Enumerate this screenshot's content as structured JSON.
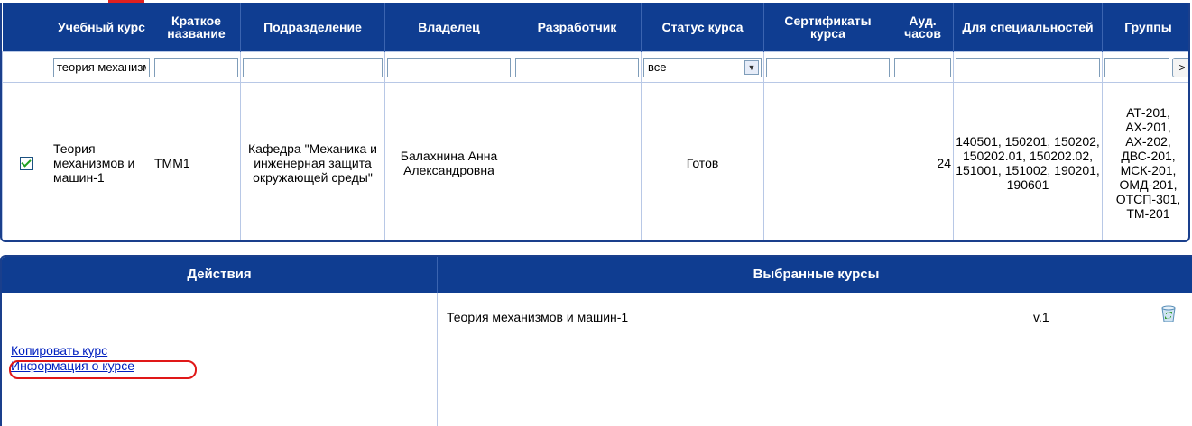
{
  "headers": {
    "course": "Учебный курс",
    "short_name": "Краткое название",
    "department": "Подразделение",
    "owner": "Владелец",
    "developer": "Разработчик",
    "status": "Статус курса",
    "certificates": "Сертификаты курса",
    "hours": "Ауд. часов",
    "specialties": "Для специальностей",
    "groups": "Группы"
  },
  "filters": {
    "course_value": "теория механизмов",
    "status_value": "все",
    "go_label": ">"
  },
  "row": {
    "course": "Теория механизмов и машин-1",
    "short_name": "ТММ1",
    "department": "Кафедра \"Механика и инженерная защита окружающей среды\"",
    "owner": "Балахнина Анна Александровна",
    "developer": "",
    "status": "Готов",
    "certificates": "",
    "hours": "24",
    "specialties": "140501, 150201, 150202, 150202.01, 150202.02, 151001, 151002, 190201, 190601",
    "groups": "АТ-201, АХ-201, АХ-202, ДВС-201, МСК-201, ОМД-201, ОТСП-301, ТМ-201"
  },
  "bottom": {
    "actions_header": "Действия",
    "selected_header": "Выбранные курсы",
    "copy_link": "Копировать курс",
    "info_link": "Информация о курсе",
    "selected_course": "Теория механизмов и машин-1",
    "selected_version": "v.1"
  },
  "icons": {
    "recycle": "recycle-bin-icon",
    "dropdown": "chevron-down-icon",
    "checkbox": "checkmark-icon"
  },
  "colors": {
    "header_bg": "#0f3d91",
    "border": "#1a3f8c",
    "link": "#0020c0",
    "highlight": "#e01818"
  }
}
